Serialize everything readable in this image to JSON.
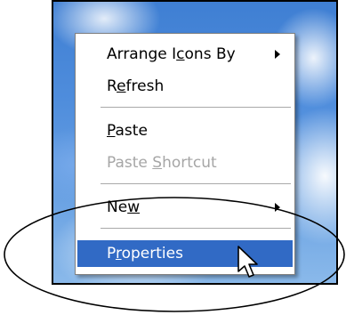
{
  "context_menu": {
    "items": [
      {
        "label": "Arrange Icons By",
        "mnemonic_index": 9,
        "submenu": true
      },
      {
        "label": "Refresh",
        "mnemonic_index": 1
      },
      {
        "label": "Paste",
        "mnemonic_index": 0
      },
      {
        "label": "Paste Shortcut",
        "mnemonic_index": 6,
        "disabled": true
      },
      {
        "label": "New",
        "mnemonic_index": 2,
        "submenu": true
      },
      {
        "label": "Properties",
        "mnemonic_index": 1,
        "selected": true
      }
    ]
  },
  "colors": {
    "highlight": "#316ac5",
    "disabled_text": "#a6a6a6",
    "desktop_sky": "#4f8ddc"
  },
  "icons": {
    "submenu_arrow": "chevron-right-icon",
    "cursor": "mouse-pointer-icon"
  }
}
